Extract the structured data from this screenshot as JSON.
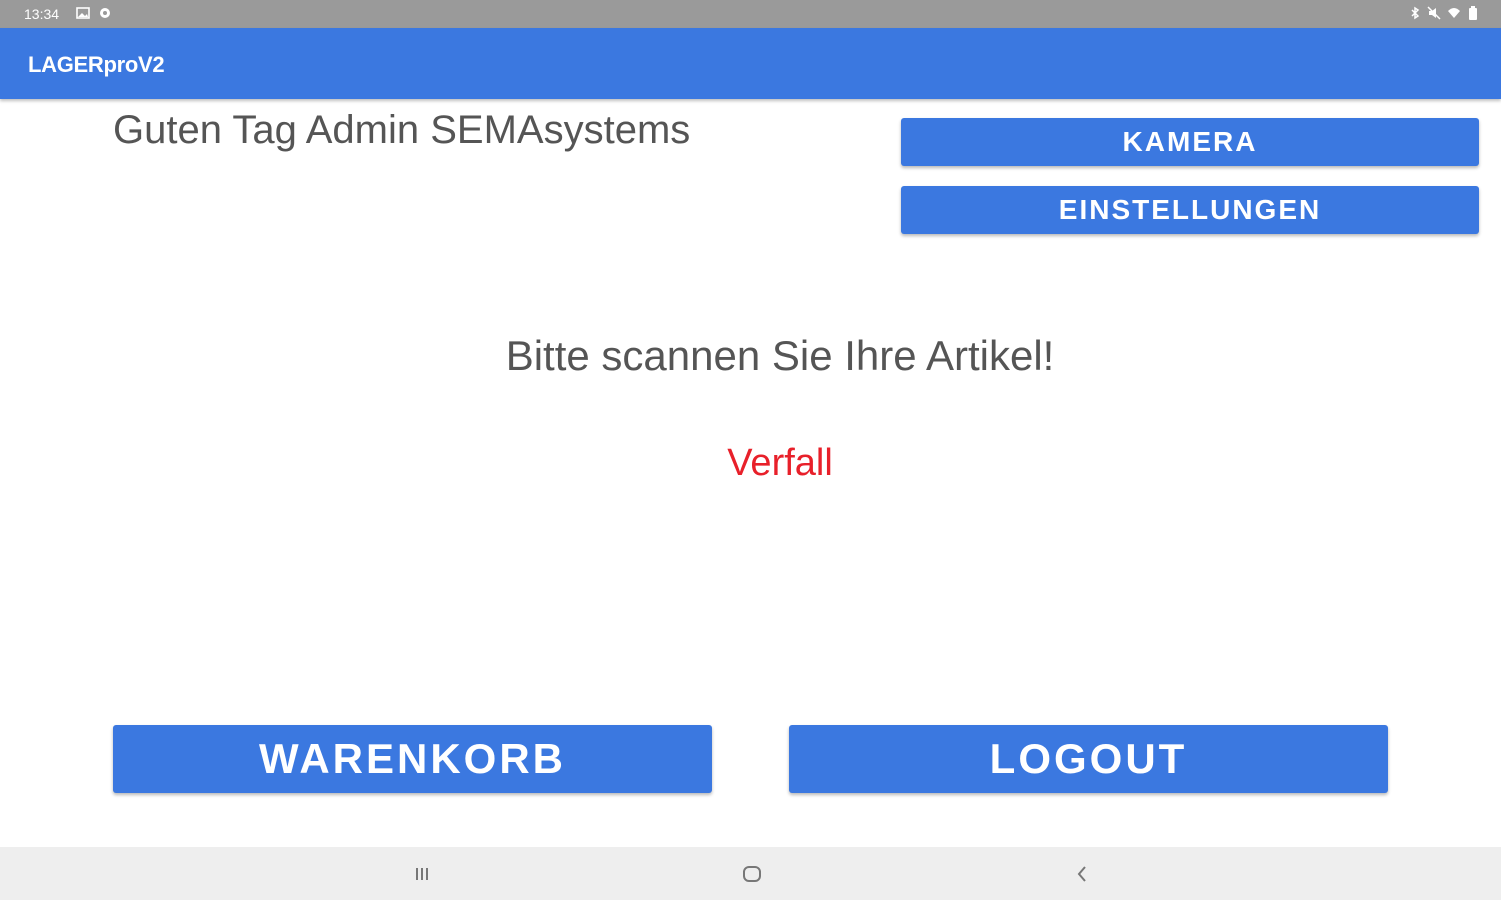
{
  "status_bar": {
    "time": "13:34",
    "left_icons": [
      "image-icon",
      "settings-gear-icon"
    ],
    "right_icons": [
      "bluetooth-icon",
      "mute-icon",
      "wifi-icon",
      "battery-icon"
    ]
  },
  "app_bar": {
    "title": "LAGERproV2"
  },
  "main": {
    "greeting": "Guten Tag Admin SEMAsystems",
    "camera_button": "KAMERA",
    "settings_button": "EINSTELLUNGEN",
    "prompt": "Bitte scannen Sie Ihre Artikel!",
    "status_text": "Verfall",
    "cart_button": "WARENKORB",
    "logout_button": "LOGOUT"
  },
  "nav_bar": {
    "icons": [
      "recent-apps-icon",
      "home-icon",
      "back-icon"
    ]
  },
  "colors": {
    "accent": "#3b78e0",
    "status_red": "#e8202a",
    "text_gray": "#555555",
    "status_bar": "#9a9a9a",
    "nav_bar": "#eeeeee"
  }
}
